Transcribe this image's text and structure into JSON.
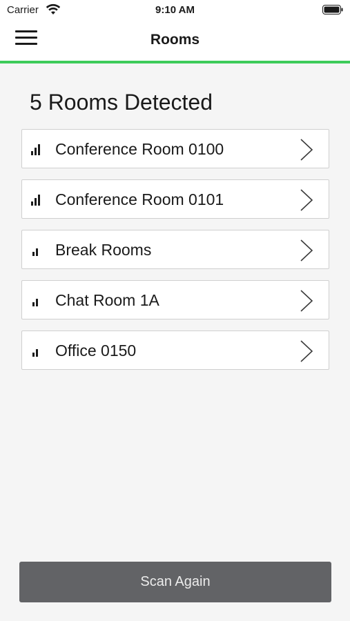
{
  "status_bar": {
    "carrier": "Carrier",
    "time": "9:10 AM",
    "wifi_icon": "wifi-icon",
    "battery_icon": "battery-icon"
  },
  "nav": {
    "title": "Rooms",
    "menu_icon": "hamburger-menu-icon"
  },
  "accent_color": "#3dcb5a",
  "rooms_heading": "5 Rooms Detected",
  "rooms": [
    {
      "name": "Conference Room 0100",
      "signal_bars": 3
    },
    {
      "name": "Conference Room 0101",
      "signal_bars": 3
    },
    {
      "name": "Break Rooms",
      "signal_bars": 2
    },
    {
      "name": "Chat Room 1A",
      "signal_bars": 2
    },
    {
      "name": "Office 0150",
      "signal_bars": 2
    }
  ],
  "scan_button": {
    "label": "Scan Again",
    "color": "#626366"
  }
}
